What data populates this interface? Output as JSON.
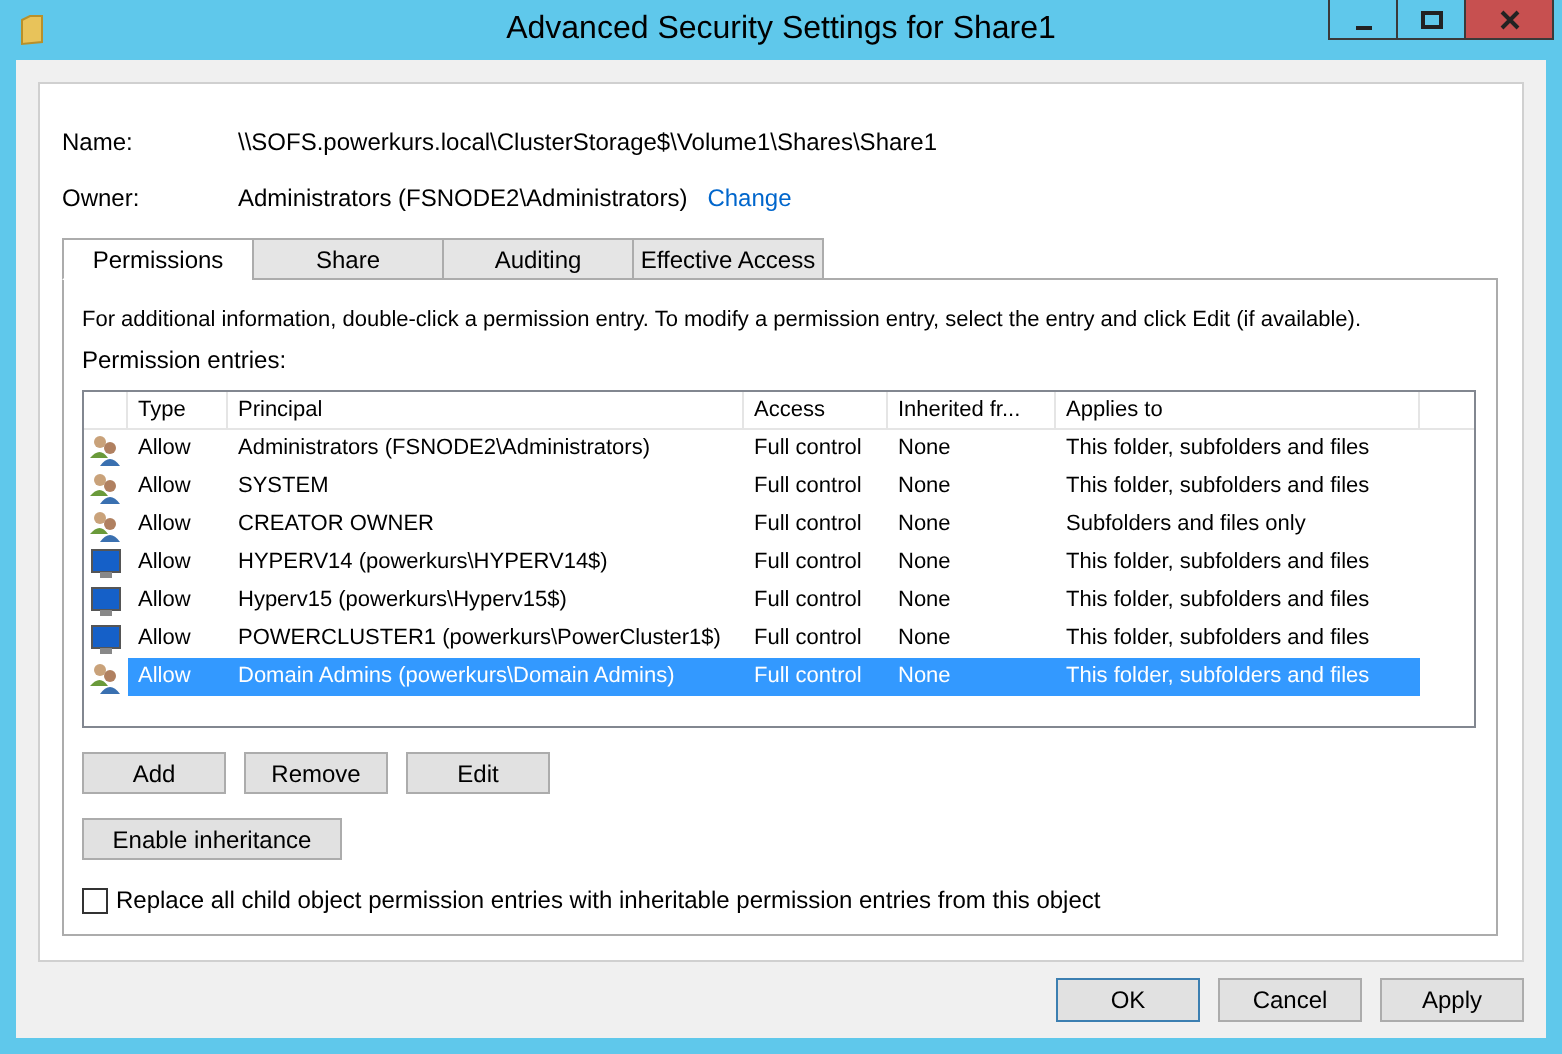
{
  "window": {
    "title": "Advanced Security Settings for Share1"
  },
  "fields": [
    {
      "label": "Name:",
      "value": "\\\\SOFS.powerkurs.local\\ClusterStorage$\\Volume1\\Shares\\Share1"
    },
    {
      "label": "Owner:",
      "value": "Administrators (FSNODE2\\Administrators)",
      "link": "Change"
    }
  ],
  "tabs": [
    {
      "label": "Permissions",
      "selected": true
    },
    {
      "label": "Share",
      "selected": false
    },
    {
      "label": "Auditing",
      "selected": false
    },
    {
      "label": "Effective Access",
      "selected": false
    }
  ],
  "info": "For additional information, double-click a permission entry. To modify a permission entry, select the entry and click Edit (if available).",
  "entries_label": "Permission entries:",
  "table": {
    "columns": [
      "Type",
      "Principal",
      "Access",
      "Inherited fr...",
      "Applies to"
    ],
    "rows": [
      {
        "kind": "group",
        "selected": false,
        "cells": [
          "Allow",
          "Administrators (FSNODE2\\Administrators)",
          "Full control",
          "None",
          "This folder, subfolders and files"
        ]
      },
      {
        "kind": "group",
        "selected": false,
        "cells": [
          "Allow",
          "SYSTEM",
          "Full control",
          "None",
          "This folder, subfolders and files"
        ]
      },
      {
        "kind": "group",
        "selected": false,
        "cells": [
          "Allow",
          "CREATOR OWNER",
          "Full control",
          "None",
          "Subfolders and files only"
        ]
      },
      {
        "kind": "computer",
        "selected": false,
        "cells": [
          "Allow",
          "HYPERV14 (powerkurs\\HYPERV14$)",
          "Full control",
          "None",
          "This folder, subfolders and files"
        ]
      },
      {
        "kind": "computer",
        "selected": false,
        "cells": [
          "Allow",
          "Hyperv15 (powerkurs\\Hyperv15$)",
          "Full control",
          "None",
          "This folder, subfolders and files"
        ]
      },
      {
        "kind": "computer",
        "selected": false,
        "cells": [
          "Allow",
          "POWERCLUSTER1 (powerkurs\\PowerCluster1$)",
          "Full control",
          "None",
          "This folder, subfolders and files"
        ]
      },
      {
        "kind": "group",
        "selected": true,
        "cells": [
          "Allow",
          "Domain Admins (powerkurs\\Domain Admins)",
          "Full control",
          "None",
          "This folder, subfolders and files"
        ]
      }
    ]
  },
  "row_buttons": [
    "Add",
    "Remove",
    "Edit"
  ],
  "inherit_button": "Enable inheritance",
  "replace_option": {
    "label": "Replace all child object permission entries with inheritable permission entries from this object",
    "checked": false
  },
  "dialog_buttons": [
    {
      "label": "OK",
      "default": true
    },
    {
      "label": "Cancel",
      "default": false
    },
    {
      "label": "Apply",
      "default": false
    }
  ]
}
